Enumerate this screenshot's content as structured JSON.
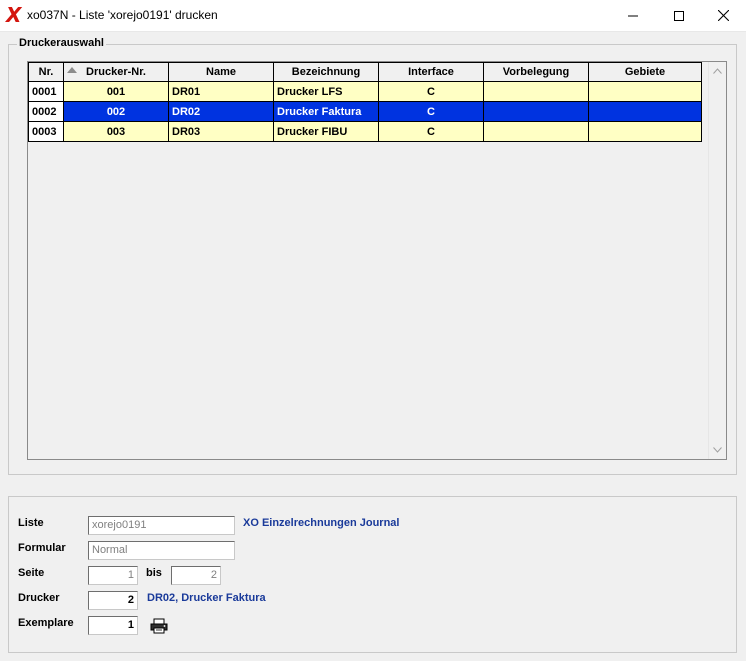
{
  "window": {
    "title": "xo037N - Liste 'xorejo0191' drucken",
    "logo_glyph": "X",
    "logo_color": "#d4150e"
  },
  "printer_group": {
    "label": "Druckerauswahl",
    "columns": [
      "Nr.",
      "Drucker-Nr.",
      "Name",
      "Bezeichnung",
      "Interface",
      "Vorbelegung",
      "Gebiete"
    ],
    "rows": [
      {
        "nr": "0001",
        "drucker_nr": "001",
        "name": "DR01",
        "bezeichnung": "Drucker LFS",
        "interface": "C",
        "vorbelegung": "",
        "gebiete": "",
        "selected": false
      },
      {
        "nr": "0002",
        "drucker_nr": "002",
        "name": "DR02",
        "bezeichnung": "Drucker Faktura",
        "interface": "C",
        "vorbelegung": "",
        "gebiete": "",
        "selected": true
      },
      {
        "nr": "0003",
        "drucker_nr": "003",
        "name": "DR03",
        "bezeichnung": "Drucker FIBU",
        "interface": "C",
        "vorbelegung": "",
        "gebiete": "",
        "selected": false
      }
    ],
    "selected_color": "#0033e0",
    "row_color": "#ffffc4"
  },
  "form": {
    "liste_label": "Liste",
    "liste_value": "xorejo0191",
    "liste_info": "XO Einzelrechnungen Journal",
    "formular_label": "Formular",
    "formular_value": "Normal",
    "seite_label": "Seite",
    "seite_from": "1",
    "bis_label": "bis",
    "seite_to": "2",
    "drucker_label": "Drucker",
    "drucker_value": "2",
    "drucker_info": "DR02, Drucker Faktura",
    "exemplare_label": "Exemplare",
    "exemplare_value": "1",
    "info_color": "#1a3a9a"
  },
  "icons": {
    "minimize": "minimize-icon",
    "maximize": "maximize-icon",
    "close": "close-icon",
    "print": "printer-icon",
    "sort": "sort-ascending-icon"
  }
}
